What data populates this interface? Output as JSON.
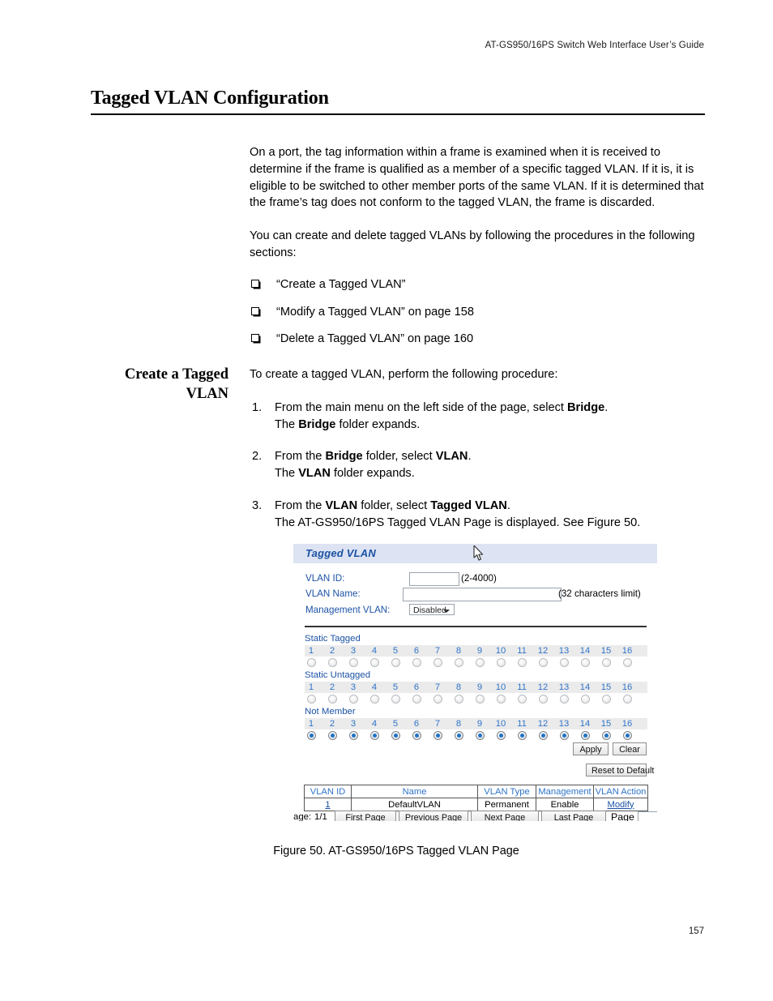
{
  "running_header": "AT-GS950/16PS Switch Web Interface User’s Guide",
  "chapter_title": "Tagged VLAN Configuration",
  "page_number": "157",
  "body": {
    "para1": "On a port, the tag information within a frame is examined when it is received to determine if the frame is qualified as a member of a specific tagged VLAN. If it is, it is eligible to be switched to other member ports of the same VLAN. If it is determined that the frame’s tag does not conform to the tagged VLAN, the frame is discarded.",
    "para2": "You can create and delete tagged VLANs by following the procedures in the following sections:",
    "bullets": [
      "“Create a Tagged VLAN”",
      "“Modify a Tagged VLAN” on page 158",
      "“Delete a Tagged VLAN” on page 160"
    ]
  },
  "section": {
    "side_heading_line1": "Create a Tagged",
    "side_heading_line2": "VLAN",
    "intro": "To create a tagged VLAN, perform the following procedure:",
    "steps": [
      {
        "num": "1.",
        "line1_a": "From the main menu on the left side of the page, select ",
        "line1_b": "Bridge",
        "line1_c": ".",
        "line2_a": "The ",
        "line2_b": "Bridge",
        "line2_c": " folder expands."
      },
      {
        "num": "2.",
        "line1_a": "From the ",
        "line1_b": "Bridge",
        "line1_c": " folder, select ",
        "line1_d": "VLAN",
        "line1_e": ".",
        "line2_a": "The ",
        "line2_b": "VLAN",
        "line2_c": " folder expands."
      },
      {
        "num": "3.",
        "line1_a": "From the ",
        "line1_b": "VLAN",
        "line1_c": " folder, select ",
        "line1_d": "Tagged VLAN",
        "line1_e": ".",
        "line2": "The AT-GS950/16PS Tagged VLAN Page is displayed. See Figure 50."
      }
    ]
  },
  "figure": {
    "caption": "Figure 50. AT-GS950/16PS Tagged VLAN Page",
    "ui": {
      "title": "Tagged VLAN",
      "fields": [
        {
          "label": "VLAN ID:",
          "value": "",
          "hint": "(2-4000)"
        },
        {
          "label": "VLAN Name:",
          "value": "",
          "hint": "(32 characters limit)"
        },
        {
          "label": "Management VLAN:",
          "value": "Disabled",
          "hint": ""
        }
      ],
      "management_vlan_selected": "Disabled",
      "port_numbers": [
        "1",
        "2",
        "3",
        "4",
        "5",
        "6",
        "7",
        "8",
        "9",
        "10",
        "11",
        "12",
        "13",
        "14",
        "15",
        "16"
      ],
      "port_groups": [
        {
          "label": "Static Tagged",
          "selected": false
        },
        {
          "label": "Static Untagged",
          "selected": false
        },
        {
          "label": "Not Member",
          "selected": true
        }
      ],
      "buttons": {
        "apply": "Apply",
        "clear": "Clear",
        "reset": "Reset to Default"
      },
      "table": {
        "headers": [
          "VLAN ID",
          "Name",
          "VLAN Type",
          "Management",
          "VLAN Action"
        ],
        "rows": [
          {
            "vlan_id": "1",
            "name": "DefaultVLAN",
            "vlan_type": "Permanent",
            "management": "Enable",
            "action": "Modify"
          }
        ]
      },
      "pager": {
        "page_label_clipped": "age:",
        "page_count": "1/1",
        "first": "First Page",
        "previous": "Previous Page",
        "next": "Next Page",
        "last": "Last Page",
        "page_field_label": "Page",
        "page_field_value": ""
      }
    }
  },
  "colors": {
    "ui_title_bar": "#dde3f2",
    "ui_link_blue": "#1b52a4",
    "ui_port_num_blue": "#2f74c9",
    "ui_strip_gray": "#ebebeb",
    "radio_selected": "#1f72c4"
  }
}
